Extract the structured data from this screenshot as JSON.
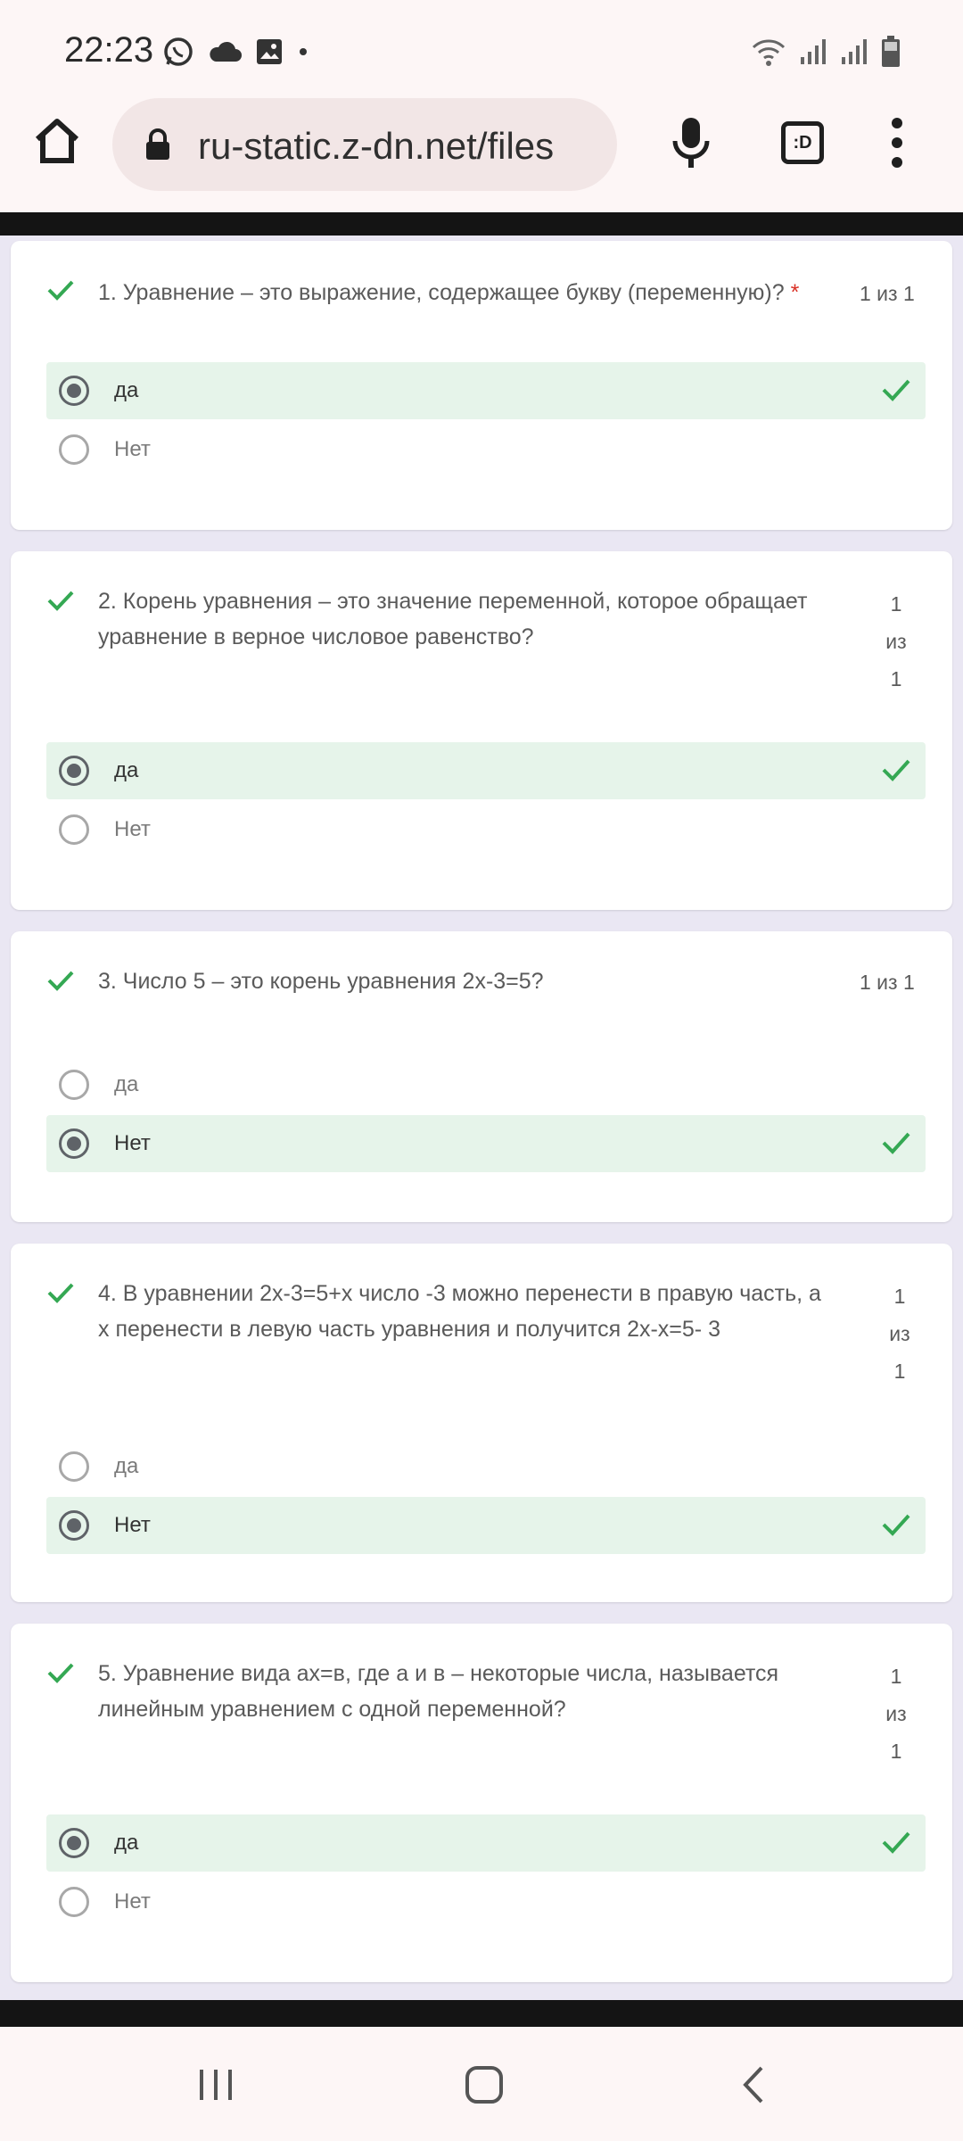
{
  "status_bar": {
    "time": "22:23"
  },
  "browser": {
    "url": "ru-static.z-dn.net/files",
    "tab_switcher_label": ":D"
  },
  "colors": {
    "correct_green": "#34a853",
    "correct_bg": "#e6f4ea",
    "page_bg": "#eae7f3"
  },
  "questions": [
    {
      "text": "1. Уравнение – это выражение, содержащее букву (переменную)?",
      "required_mark": "*",
      "score": "1 из 1",
      "score_lines": [
        "1",
        "из",
        "1"
      ],
      "options": [
        {
          "label": "да",
          "selected": true,
          "correct": true
        },
        {
          "label": "Нет",
          "selected": false,
          "correct": false
        }
      ]
    },
    {
      "text_lines": [
        "2. Корень уравнения – это значение переменной, которое обращает",
        "уравнение в верное числовое равенство?"
      ],
      "score_lines": [
        "1",
        "из",
        "1"
      ],
      "options": [
        {
          "label": "да",
          "selected": true,
          "correct": true
        },
        {
          "label": "Нет",
          "selected": false,
          "correct": false
        }
      ]
    },
    {
      "text": "3. Число 5 – это корень уравнения 2х-3=5?",
      "score": "1 из 1",
      "options": [
        {
          "label": "да",
          "selected": false,
          "correct": false
        },
        {
          "label": "Нет",
          "selected": true,
          "correct": true
        }
      ]
    },
    {
      "text_lines": [
        "4. В уравнении 2х-3=5+х число -3 можно перенести в правую часть, а",
        "х перенести в левую часть уравнения и получится 2х-х=5- 3"
      ],
      "score_lines": [
        "1",
        "из",
        "1"
      ],
      "options": [
        {
          "label": "да",
          "selected": false,
          "correct": false
        },
        {
          "label": "Нет",
          "selected": true,
          "correct": true
        }
      ]
    },
    {
      "text_lines": [
        "5. Уравнение вида ах=в, где а и в – некоторые числа, называется",
        "линейным уравнением с одной переменной?"
      ],
      "score_lines": [
        "1",
        "из",
        "1"
      ],
      "options": [
        {
          "label": "да",
          "selected": true,
          "correct": true
        },
        {
          "label": "Нет",
          "selected": false,
          "correct": false
        }
      ]
    }
  ]
}
